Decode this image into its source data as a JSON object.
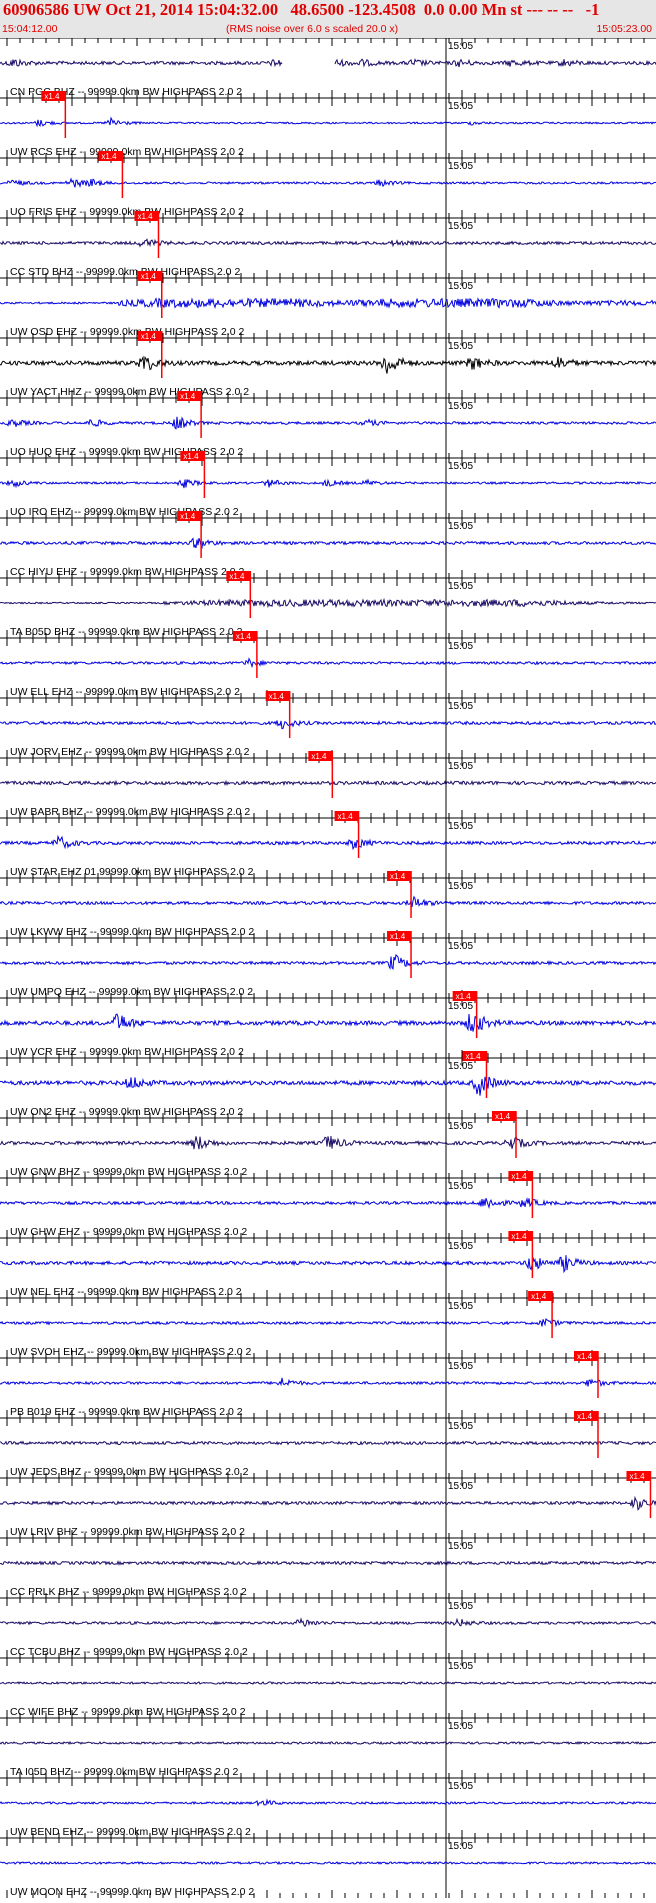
{
  "header": {
    "title": "60906586 UW Oct 21, 2014 15:04:32.00   48.6500 -123.4508  0.0 0.00 Mn st --- -- --   -1",
    "start_time": "15:04:12.00",
    "noise_note": "(RMS noise over 6.0 s scaled 20.0 x)",
    "end_time": "15:05:23.00"
  },
  "colors": {
    "title": "#e00000",
    "header_bg": "#e6e6e6",
    "trace_blue": "#0000e0",
    "trace_navy": "#1a0a66",
    "trace_black": "#000000",
    "pick_marker": "#ff0000",
    "axis": "#000000"
  },
  "chart_data": {
    "type": "line",
    "x_range": [
      "15:04:12.00",
      "15:05:23.00"
    ],
    "time_mark": "15:05",
    "pick_label": "x1.4",
    "traces": [
      {
        "label": "CN PGC BHZ -- 99999.0km BW  HIGHPASS  2.0  2",
        "color": "navy",
        "amplitude": 0.16,
        "pick": null,
        "bursts": [
          [
            0.02,
            0.4
          ],
          [
            0.42,
            0.3
          ],
          [
            0.5,
            0.6
          ],
          [
            0.55,
            0.3
          ],
          [
            0.63,
            0.3
          ],
          [
            0.7,
            0.3
          ],
          [
            0.78,
            0.3
          ],
          [
            0.86,
            0.3
          ]
        ],
        "gaps": [
          [
            0.43,
            0.51
          ]
        ]
      },
      {
        "label": "UW RCS EHZ -- 99999.0km BW  HIGHPASS  2.0  2",
        "color": "blue",
        "amplitude": 0.08,
        "pick": 0.063,
        "bursts": [
          [
            0.06,
            0.7
          ],
          [
            0.17,
            1.0
          ],
          [
            0.72,
            0.3
          ]
        ]
      },
      {
        "label": "UO FRIS EHZ -- 99999.0km BW  HIGHPASS  2.0  2",
        "color": "blue",
        "amplitude": 0.1,
        "pick": 0.15,
        "bursts": [
          [
            0.02,
            0.5
          ],
          [
            0.11,
            0.8
          ],
          [
            0.14,
            0.5
          ],
          [
            0.58,
            0.5
          ]
        ]
      },
      {
        "label": "CC STD BHZ -- 99999.0km BW  HIGHPASS  2.0  2",
        "color": "navy",
        "amplitude": 0.14,
        "pick": 0.205,
        "bursts": [
          [
            0.22,
            0.5
          ],
          [
            0.6,
            0.2
          ]
        ]
      },
      {
        "label": "UW OSD EHZ -- 99999.0km BW  HIGHPASS  2.0  2",
        "color": "blue",
        "amplitude": 0.15,
        "pick": 0.21,
        "bursts": [],
        "envelope": [
          [
            0.18,
            0.6
          ],
          [
            0.24,
            1.0
          ],
          [
            0.45,
            1.0
          ],
          [
            0.52,
            0.6
          ],
          [
            0.6,
            1.0
          ],
          [
            0.8,
            1.0
          ],
          [
            0.86,
            0.5
          ],
          [
            1.0,
            0.6
          ]
        ]
      },
      {
        "label": "UW YACT HHZ -- 99999.0km BW  HIGHPASS  2.0  2",
        "color": "black",
        "amplitude": 0.2,
        "pick": 0.21,
        "bursts": [
          [
            0.22,
            0.7
          ],
          [
            0.59,
            1.0
          ],
          [
            0.72,
            0.5
          ],
          [
            0.85,
            0.5
          ]
        ]
      },
      {
        "label": "UO HUQ EHZ -- 99999.0km BW  HIGHPASS  2.0  2",
        "color": "blue",
        "amplitude": 0.12,
        "pick": 0.27,
        "bursts": [
          [
            0.02,
            0.5
          ],
          [
            0.14,
            0.5
          ],
          [
            0.27,
            0.9
          ],
          [
            0.56,
            0.4
          ]
        ]
      },
      {
        "label": "UO IRO EHZ -- 99999.0km BW  HIGHPASS  2.0  2",
        "color": "blue",
        "amplitude": 0.1,
        "pick": 0.275,
        "bursts": [
          [
            0.02,
            0.6
          ],
          [
            0.28,
            0.7
          ],
          [
            0.41,
            0.6
          ],
          [
            0.5,
            0.5
          ],
          [
            0.56,
            0.4
          ]
        ]
      },
      {
        "label": "CC HIYU EHZ -- 99999.0km BW  HIGHPASS  2.0  2",
        "color": "blue",
        "amplitude": 0.14,
        "pick": 0.27,
        "bursts": [
          [
            0.3,
            0.7
          ]
        ]
      },
      {
        "label": "TA B05D BHZ -- 99999.0km BW  HIGHPASS  2.0  2",
        "color": "navy",
        "amplitude": 0.12,
        "pick": 0.345,
        "bursts": [],
        "envelope": [
          [
            0.25,
            0.4
          ],
          [
            0.35,
            0.9
          ],
          [
            0.5,
            1.0
          ],
          [
            0.65,
            0.9
          ],
          [
            0.8,
            1.0
          ],
          [
            0.9,
            0.4
          ],
          [
            1.0,
            0.2
          ]
        ]
      },
      {
        "label": "UW ELL EHZ -- 99999.0km BW  HIGHPASS  2.0  2",
        "color": "blue",
        "amplitude": 0.12,
        "pick": 0.355,
        "bursts": [
          [
            0.38,
            0.5
          ]
        ]
      },
      {
        "label": "UW JORV EHZ -- 99999.0km BW  HIGHPASS  2.0  2",
        "color": "blue",
        "amplitude": 0.14,
        "pick": 0.405,
        "bursts": [
          [
            0.43,
            0.6
          ]
        ]
      },
      {
        "label": "UW BABR BHZ -- 99999.0km BW  HIGHPASS  2.0  2",
        "color": "navy",
        "amplitude": 0.16,
        "pick": 0.47,
        "bursts": []
      },
      {
        "label": "UW STAR EHZ 01 99999.0km BW  HIGHPASS  2.0  2",
        "color": "blue",
        "amplitude": 0.15,
        "pick": 0.51,
        "bursts": [
          [
            0.09,
            0.7
          ],
          [
            0.54,
            0.6
          ]
        ]
      },
      {
        "label": "UW LKWW EHZ -- 99999.0km BW  HIGHPASS  2.0  2",
        "color": "blue",
        "amplitude": 0.14,
        "pick": 0.59,
        "bursts": [
          [
            0.63,
            0.7
          ]
        ]
      },
      {
        "label": "UW UMPQ EHZ -- 99999.0km BW  HIGHPASS  2.0  2",
        "color": "blue",
        "amplitude": 0.14,
        "pick": 0.59,
        "bursts": [
          [
            0.6,
            1.0
          ]
        ]
      },
      {
        "label": "UW VCR EHZ -- 99999.0km BW  HIGHPASS  2.0  2",
        "color": "blue",
        "amplitude": 0.2,
        "pick": 0.69,
        "bursts": [
          [
            0.18,
            0.8
          ],
          [
            0.72,
            1.0
          ]
        ]
      },
      {
        "label": "UW ON2 EHZ -- 99999.0km BW  HIGHPASS  2.0  2",
        "color": "blue",
        "amplitude": 0.2,
        "pick": 0.705,
        "bursts": [
          [
            0.2,
            0.5
          ],
          [
            0.73,
            1.0
          ]
        ]
      },
      {
        "label": "UW GNW BHZ -- 99999.0km BW  HIGHPASS  2.0  2",
        "color": "navy",
        "amplitude": 0.16,
        "pick": 0.75,
        "bursts": [
          [
            0.3,
            0.8
          ],
          [
            0.5,
            0.8
          ],
          [
            0.78,
            0.7
          ]
        ]
      },
      {
        "label": "UW GHW EHZ -- 99999.0km BW  HIGHPASS  2.0  2",
        "color": "blue",
        "amplitude": 0.14,
        "pick": 0.775,
        "bursts": [
          [
            0.74,
            0.8
          ],
          [
            0.8,
            0.6
          ]
        ]
      },
      {
        "label": "UW NEL EHZ -- 99999.0km BW  HIGHPASS  2.0  2",
        "color": "blue",
        "amplitude": 0.16,
        "pick": 0.775,
        "bursts": [
          [
            0.81,
            0.8
          ],
          [
            0.86,
            0.8
          ]
        ]
      },
      {
        "label": "UW SVOH EHZ -- 99999.0km BW  HIGHPASS  2.0  2",
        "color": "blue",
        "amplitude": 0.12,
        "pick": 0.805,
        "bursts": [
          [
            0.83,
            0.6
          ]
        ]
      },
      {
        "label": "PB B019 EHZ -- 99999.0km BW  HIGHPASS  2.0  2",
        "color": "blue",
        "amplitude": 0.12,
        "pick": 0.875,
        "bursts": [
          [
            0.43,
            0.6
          ],
          [
            0.9,
            0.6
          ]
        ]
      },
      {
        "label": "UW JEDS BHZ -- 99999.0km BW  HIGHPASS  2.0  2",
        "color": "navy",
        "amplitude": 0.14,
        "pick": 0.875,
        "bursts": []
      },
      {
        "label": "UW LRIV BHZ -- 99999.0km BW  HIGHPASS  2.0  2",
        "color": "navy",
        "amplitude": 0.14,
        "pick": 0.955,
        "bursts": [
          [
            0.97,
            0.8
          ]
        ]
      },
      {
        "label": "CC PRLK BHZ -- 99999.0km BW  HIGHPASS  2.0  2",
        "color": "navy",
        "amplitude": 0.14,
        "pick": null,
        "bursts": []
      },
      {
        "label": "CC TCBU BHZ -- 99999.0km BW  HIGHPASS  2.0  2",
        "color": "navy",
        "amplitude": 0.12,
        "pick": null,
        "bursts": [
          [
            0.46,
            0.6
          ],
          [
            0.7,
            0.5
          ]
        ]
      },
      {
        "label": "CC WIFE BHZ -- 99999.0km BW  HIGHPASS  2.0  2",
        "color": "navy",
        "amplitude": 0.1,
        "pick": null,
        "bursts": []
      },
      {
        "label": "TA I05D BHZ -- 99999.0km BW  HIGHPASS  2.0  2",
        "color": "navy",
        "amplitude": 0.1,
        "pick": null,
        "bursts": []
      },
      {
        "label": "UW BEND EHZ -- 99999.0km BW  HIGHPASS  2.0  2",
        "color": "blue",
        "amplitude": 0.1,
        "pick": null,
        "bursts": [
          [
            0.4,
            0.5
          ]
        ]
      },
      {
        "label": "UW MOON EHZ -- 99999.0km BW  HIGHPASS  2.0  2",
        "color": "blue",
        "amplitude": 0.1,
        "pick": null,
        "bursts": []
      }
    ]
  }
}
